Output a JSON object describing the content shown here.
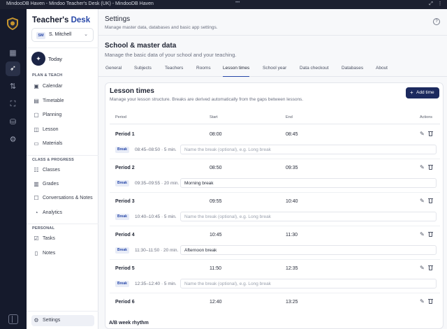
{
  "window": {
    "title": "MindooDB Haven - Mindoo Teacher's Desk (UK) - MindooDB Haven"
  },
  "rail": {
    "items": [
      {
        "icon": "dashboard-icon"
      },
      {
        "icon": "rocket-icon"
      },
      {
        "icon": "transfer-icon"
      },
      {
        "icon": "scan-icon"
      },
      {
        "icon": "database-icon"
      },
      {
        "icon": "sliders-icon"
      }
    ]
  },
  "sidebar": {
    "brand_part1": "Teacher's ",
    "brand_part2": "Desk",
    "user": {
      "initials": "SM",
      "name": "S. Mitchell"
    },
    "today_label": "Today",
    "sections": {
      "plan": "PLAN & TEACH",
      "class": "CLASS & PROGRESS",
      "personal": "PERSONAL"
    },
    "items": [
      {
        "label": "Calendar"
      },
      {
        "label": "Timetable"
      },
      {
        "label": "Planning"
      },
      {
        "label": "Lesson"
      },
      {
        "label": "Materials"
      },
      {
        "label": "Classes"
      },
      {
        "label": "Grades"
      },
      {
        "label": "Conversations & Notes"
      },
      {
        "label": "Analytics"
      },
      {
        "label": "Tasks"
      },
      {
        "label": "Notes"
      }
    ],
    "settings_label": "Settings"
  },
  "header": {
    "title": "Settings",
    "subtitle": "Manage master data, databases and basic app settings.",
    "help": "?"
  },
  "section": {
    "title": "School & master data",
    "subtitle": "Manage the basic data of your school and your teaching."
  },
  "tabs": [
    {
      "label": "General"
    },
    {
      "label": "Subjects"
    },
    {
      "label": "Teachers"
    },
    {
      "label": "Rooms"
    },
    {
      "label": "Lesson times"
    },
    {
      "label": "School year"
    },
    {
      "label": "Data checkout"
    },
    {
      "label": "Databases"
    },
    {
      "label": "About"
    }
  ],
  "card": {
    "title": "Lesson times",
    "subtitle": "Manage your lesson structure. Breaks are derived automatically from the gaps between lessons.",
    "add_button": "Add time",
    "columns": {
      "period": "Period",
      "start": "Start",
      "end": "End",
      "actions": "Actions"
    },
    "break_label": "Break",
    "break_placeholder": "Name the break (optional), e.g. Long break",
    "rows": [
      {
        "period": "Period 1",
        "start": "08:00",
        "end": "08:45",
        "break_time": "08:45–08:50 · 5 min.",
        "break_name": ""
      },
      {
        "period": "Period 2",
        "start": "08:50",
        "end": "09:35",
        "break_time": "09:35–09:55 · 20 min.",
        "break_name": "Morning break"
      },
      {
        "period": "Period 3",
        "start": "09:55",
        "end": "10:40",
        "break_time": "10:40–10:45 · 5 min.",
        "break_name": ""
      },
      {
        "period": "Period 4",
        "start": "10:45",
        "end": "11:30",
        "break_time": "11:30–11:50 · 20 min.",
        "break_name": "Afternoon break"
      },
      {
        "period": "Period 5",
        "start": "11:50",
        "end": "12:35",
        "break_time": "12:35–12:40 · 5 min.",
        "break_name": ""
      },
      {
        "period": "Period 6",
        "start": "12:40",
        "end": "13:25"
      }
    ]
  },
  "ab_week": {
    "title": "A/B week rhythm"
  },
  "colors": {
    "accent": "#2747a8",
    "rail_bg": "#151a2c",
    "button_bg": "#1c2a5e"
  }
}
